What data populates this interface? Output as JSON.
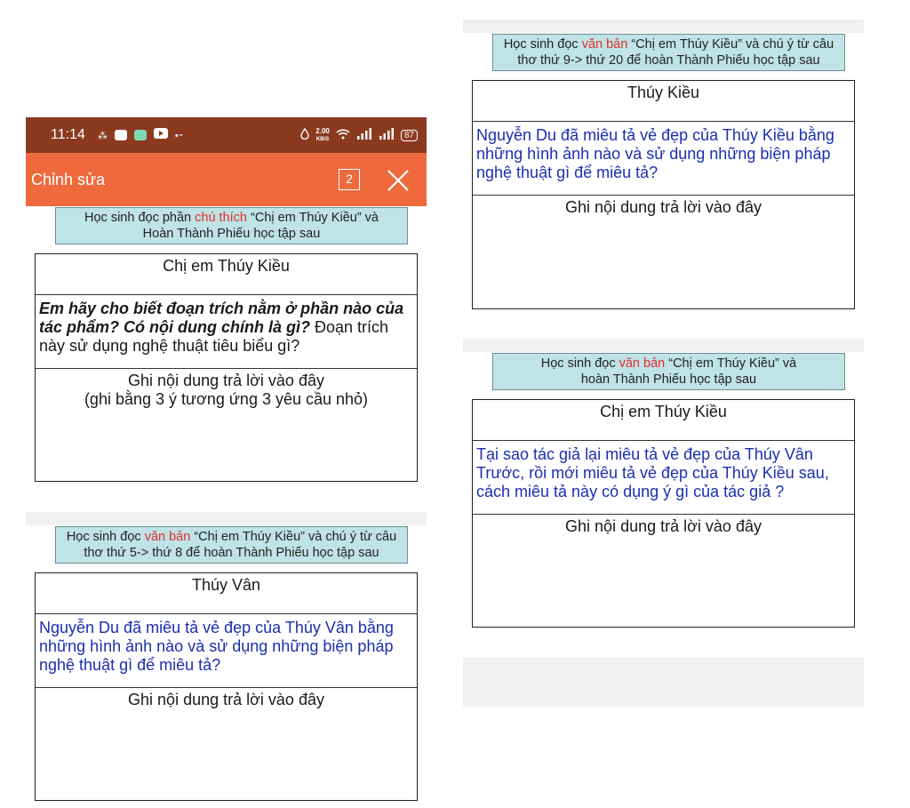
{
  "status_bar": {
    "time": "11:14",
    "speed_value": "2.00",
    "speed_unit": "KB/S",
    "battery": "87"
  },
  "edit_bar": {
    "title": "Chỉnh sửa",
    "count": "2"
  },
  "sections": [
    {
      "banner_prefix": "Học sinh đọc phần ",
      "banner_highlight": "chú thích",
      "banner_suffix": " “Chị em Thúy Kiều” và",
      "banner_line2": "Hoàn Thành Phiếu học tập sau",
      "title": "Chị em Thúy Kiều",
      "question_bold_italic": "Em hãy cho biết đoạn trích nằm ở phần nào của tác phẩm? Có nội dung chính là gì?",
      "question_plain": " Đoạn trích này sử dụng nghệ thuật tiêu biểu gì?",
      "answer_line1": "Ghi nội dung trả lời vào đây",
      "answer_line2": "(ghi bằng 3 ý tương ứng 3 yêu cầu nhỏ)"
    },
    {
      "banner_prefix": "Học sinh đọc ",
      "banner_highlight": "văn bản",
      "banner_suffix": " “Chị em Thúy Kiều” và chú ý từ câu",
      "banner_line2": "thơ thứ 5-> thứ 8 để hoàn Thành Phiếu học tập sau",
      "title": "Thúy Vân",
      "question": "Nguyễn Du đã miêu tả vẻ đẹp của Thúy Vân bằng những hình ảnh nào và sử dụng những biện pháp nghệ thuật gì để miêu tả?",
      "answer_line1": "Ghi nội dung trả lời vào đây"
    },
    {
      "banner_prefix": "Học sinh đọc ",
      "banner_highlight": "văn bản",
      "banner_suffix": " “Chị em Thúy Kiều” và chú ý từ câu",
      "banner_line2": "thơ thứ 9-> thứ 20 để hoàn Thành Phiếu học tập sau",
      "title": "Thúy Kiều",
      "question": "Nguyễn Du đã miêu tả vẻ đẹp của Thúy Kiều bằng những hình ảnh nào và sử dụng những biện pháp nghệ thuật gì để miêu tả?",
      "answer_line1": "Ghi nội dung trả lời vào đây"
    },
    {
      "banner_prefix": "Học sinh đọc ",
      "banner_highlight": "văn bản",
      "banner_suffix": " “Chị em Thúy Kiều” và",
      "banner_line2": "hoàn Thành Phiếu học tập sau",
      "title": "Chị em Thúy Kiều",
      "question": "Tại sao tác giả lại miêu tả vẻ đẹp của Thúy Vân Trước, rồi mới miêu tả vẻ đẹp của Thúy Kiều sau, cách miêu tả này có dụng ý gì của tác giả ?",
      "answer_line1": "Ghi nội dung trả lời vào đây"
    }
  ]
}
